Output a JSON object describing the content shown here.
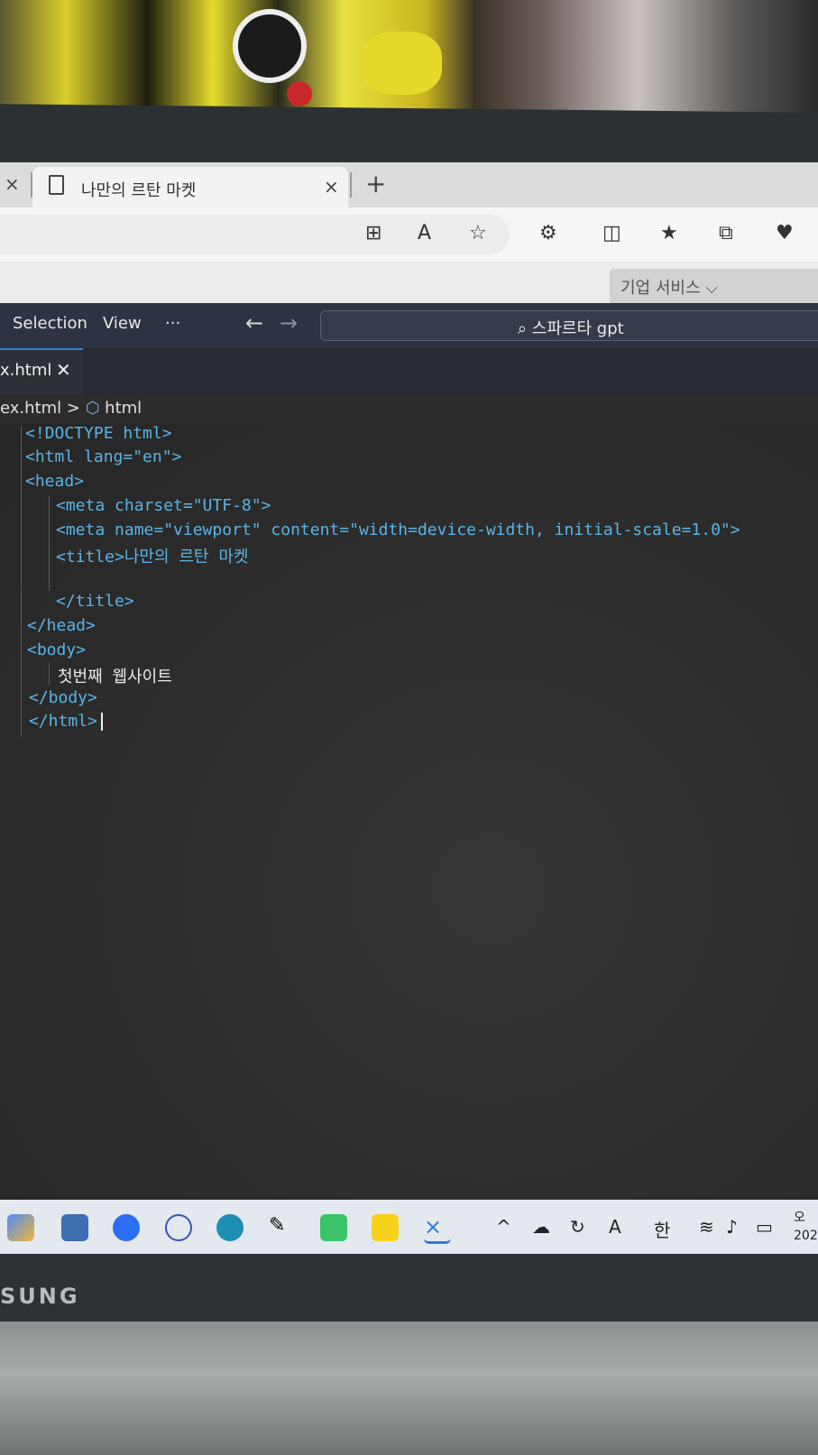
{
  "browser": {
    "prev_tab_close": "×",
    "tab_title": "나만의 르탄 마켓",
    "tab_close": "×",
    "new_tab": "+",
    "corp_services": "기업 서비스 ⌵"
  },
  "vscode": {
    "menu": [
      "Selection",
      "View",
      "···"
    ],
    "search_text": "⌕ 스파르타 gpt",
    "editor_tab": "x.html",
    "editor_tab_close": "✕",
    "breadcrumb_file": "ex.html",
    "breadcrumb_sep": ">",
    "breadcrumb_symbol": "html",
    "code_lines": [
      "<!DOCTYPE html>",
      "<html lang=\"en\">",
      "<head>",
      "<meta charset=\"UTF-8\">",
      "<meta name=\"viewport\" content=\"width=device-width, initial-scale=1.0\">",
      "<title>나만의 르탄 마켓",
      "",
      "</title>",
      "</head>",
      "<body>",
      "첫번째 웹사이트",
      "</body>",
      "</html>"
    ]
  },
  "taskbar": {
    "tray_lang": "한",
    "tray_font": "A",
    "clock_line1": "오",
    "clock_line2": "202"
  },
  "laptop": {
    "brand": "SUNG"
  }
}
